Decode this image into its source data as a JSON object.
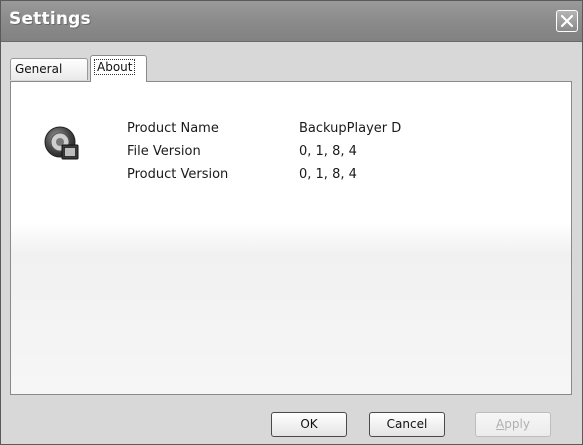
{
  "window": {
    "title": "Settings",
    "close_icon": "close-icon"
  },
  "tabs": [
    {
      "label": "General",
      "selected": false
    },
    {
      "label": "About",
      "selected": true
    }
  ],
  "about": {
    "app_icon": "backupplayer-app-icon",
    "rows": [
      {
        "label": "Product Name",
        "value": "BackupPlayer D"
      },
      {
        "label": "File Version",
        "value": "0, 1, 8, 4"
      },
      {
        "label": "Product Version",
        "value": "0, 1, 8, 4"
      }
    ]
  },
  "buttons": {
    "ok": "OK",
    "cancel": "Cancel",
    "apply_first": "A",
    "apply_rest": "pply",
    "apply_enabled": false
  }
}
